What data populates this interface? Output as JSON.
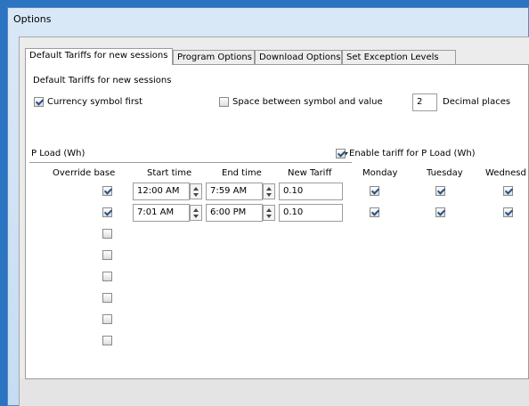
{
  "window": {
    "title": "Options"
  },
  "tabs": [
    {
      "label": "Default Tariffs for new sessions"
    },
    {
      "label": "Program Options"
    },
    {
      "label": "Download Options"
    },
    {
      "label": "Set Exception Levels"
    }
  ],
  "panel": {
    "section_title": "Default Tariffs for new sessions",
    "currency_first": {
      "label": "Currency symbol first",
      "checked": true
    },
    "space_between": {
      "label": "Space between symbol and value",
      "checked": false
    },
    "decimal_places": {
      "value": "2",
      "label": "Decimal places"
    },
    "load_select": {
      "value": "P Load (Wh)"
    },
    "enable_tariff": {
      "label": "Enable tariff for P Load (Wh)",
      "checked": true
    },
    "columns": {
      "override": "Override base",
      "start": "Start time",
      "end": "End time",
      "tariff": "New Tariff",
      "monday": "Monday",
      "tuesday": "Tuesday",
      "wednesday": "Wednesd"
    },
    "rows": [
      {
        "override": true,
        "start": "12:00 AM",
        "end": "7:59 AM",
        "tariff": "0.10",
        "monday": true,
        "tuesday": true,
        "wednesday": true
      },
      {
        "override": true,
        "start": "7:01 AM",
        "end": "6:00 PM",
        "tariff": "0.10",
        "monday": true,
        "tuesday": true,
        "wednesday": true
      },
      {
        "override": false
      },
      {
        "override": false
      },
      {
        "override": false
      },
      {
        "override": false
      },
      {
        "override": false
      },
      {
        "override": false
      }
    ]
  }
}
